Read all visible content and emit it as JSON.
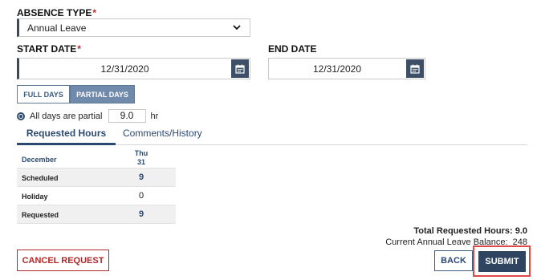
{
  "absence_type": {
    "label": "ABSENCE TYPE",
    "required_mark": "*",
    "value": "Annual Leave"
  },
  "start_date": {
    "label": "START DATE",
    "required_mark": "*",
    "value": "12/31/2020"
  },
  "end_date": {
    "label": "END DATE",
    "value": "12/31/2020"
  },
  "day_mode": {
    "options": [
      "FULL DAYS",
      "PARTIAL DAYS"
    ],
    "selected": "PARTIAL DAYS"
  },
  "partial": {
    "label": "All days are partial",
    "hours": "9.0",
    "unit": "hr"
  },
  "tabs": {
    "items": [
      "Requested Hours",
      "Comments/History"
    ],
    "active": "Requested Hours"
  },
  "grid": {
    "month": "December",
    "day_name": "Thu",
    "day_num": "31",
    "rows": [
      {
        "label": "Scheduled",
        "value": "9"
      },
      {
        "label": "Holiday",
        "value": "0"
      },
      {
        "label": "Requested",
        "value": "9"
      }
    ]
  },
  "totals": {
    "total_label": "Total Requested Hours:",
    "total_value": "9.0",
    "balance_label": "Current Annual Leave Balance:",
    "balance_value": "248"
  },
  "buttons": {
    "cancel": "CANCEL REQUEST",
    "back": "BACK",
    "submit": "SUBMIT"
  },
  "colors": {
    "accent": "#2c4a70",
    "danger": "#b12828",
    "highlight": "#e04848"
  },
  "icons": [
    "chevron-down-icon",
    "calendar-icon",
    "radio-selected-icon"
  ]
}
